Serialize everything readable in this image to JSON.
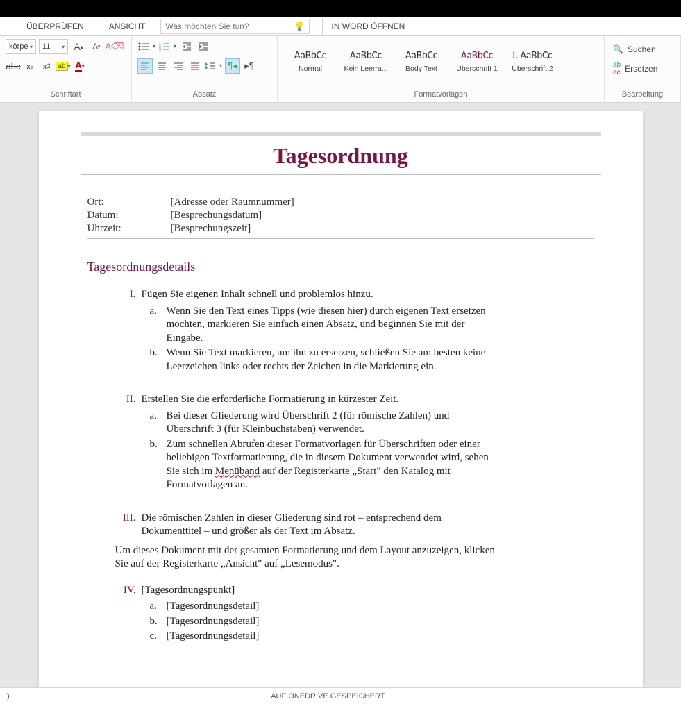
{
  "tabs": {
    "review": "ÜBERPRÜFEN",
    "view": "ANSICHT"
  },
  "tellme": {
    "placeholder": "Was möchten Sie tun?"
  },
  "openword": "IN WORD ÖFFNEN",
  "ribbon": {
    "font": {
      "label": "Schriftart",
      "fontname": "körpe",
      "fontsize": "11"
    },
    "para": {
      "label": "Absatz"
    },
    "styles": {
      "label": "Formatvorlagen",
      "items": [
        {
          "preview": "AaBbCc",
          "name": "Normal"
        },
        {
          "preview": "AaBbCc",
          "name": "Kein Leerra..."
        },
        {
          "preview": "AaBbCc",
          "name": "Body Text"
        },
        {
          "preview": "AaBbCc",
          "name": "Überschrift 1",
          "h1": true
        },
        {
          "preview": "I. AaBbCc",
          "name": "Überschrift 2"
        }
      ]
    },
    "edit": {
      "label": "Bearbeitung",
      "find": "Suchen",
      "replace": "Ersetzen"
    }
  },
  "doc": {
    "title": "Tagesordnung",
    "meta": {
      "ort_label": "Ort:",
      "ort_val": "[Adresse oder Raumnummer]",
      "datum_label": "Datum:",
      "datum_val": "[Besprechungsdatum]",
      "uhrzeit_label": "Uhrzeit:",
      "uhrzeit_val": "[Besprechungszeit]"
    },
    "section": "Tagesordnungsdetails",
    "items": {
      "i1": "Fügen Sie eigenen Inhalt schnell und problemlos hinzu.",
      "i1a": "Wenn Sie den Text eines Tipps (wie diesen hier) durch eigenen Text ersetzen möchten, markieren Sie einfach einen Absatz, und beginnen Sie mit der Eingabe.",
      "i1b": "Wenn Sie Text markieren, um ihn zu ersetzen, schließen Sie am besten keine Leerzeichen links oder rechts der Zeichen in die Markierung ein.",
      "i2": "Erstellen Sie die erforderliche Formatierung in kürzester Zeit.",
      "i2a": "Bei dieser Gliederung wird Überschrift 2 (für römische Zahlen) und Überschrift 3 (für Kleinbuchstaben) verwendet.",
      "i2b_pre": "Zum schnellen Abrufen dieser Formatvorlagen für Überschriften oder einer beliebigen Textformatierung, die in diesem Dokument verwendet wird, sehen Sie sich im ",
      "i2b_sq": "Menüband",
      "i2b_post": " auf der Registerkarte „Start\" den Katalog mit Formatvorlagen an.",
      "i3": "Die römischen Zahlen in dieser Gliederung sind rot – entsprechend dem Dokumenttitel – und größer als der Text im Absatz.",
      "body": "Um dieses Dokument mit der gesamten Formatierung und dem Layout anzuzeigen, klicken Sie auf der Registerkarte „Ansicht\" auf „Lesemodus\".",
      "i4": "[Tagesordnungspunkt]",
      "i4a": "[Tagesordnungsdetail]",
      "i4b": "[Tagesordnungsdetail]",
      "i4c": "[Tagesordnungsdetail]"
    },
    "nums": {
      "I": "I.",
      "II": "II.",
      "III": "III.",
      "IV": "IV.",
      "a": "a.",
      "b": "b.",
      "c": "c."
    }
  },
  "status": {
    "left": ")",
    "center": "AUF ONEDRIVE GESPEICHERT"
  }
}
